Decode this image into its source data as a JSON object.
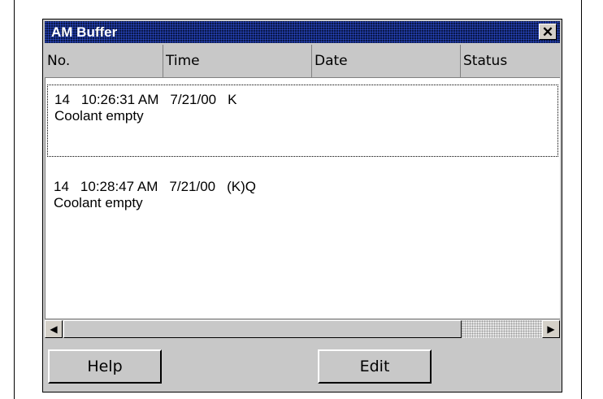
{
  "window": {
    "title": "AM Buffer",
    "close_glyph": "✕"
  },
  "columns": [
    "No.",
    "Time",
    "Date",
    "Status"
  ],
  "entries": [
    {
      "no": "14",
      "time": "10:26:31 AM",
      "date": "7/21/00",
      "status": "K",
      "message": "Coolant empty",
      "selected": true
    },
    {
      "no": "14",
      "time": "10:28:47 AM",
      "date": "7/21/00",
      "status": "(K)Q",
      "message": "Coolant empty",
      "selected": false
    }
  ],
  "scrollbar": {
    "left_arrow": "◀",
    "right_arrow": "▶"
  },
  "buttons": {
    "help": "Help",
    "edit": "Edit"
  }
}
